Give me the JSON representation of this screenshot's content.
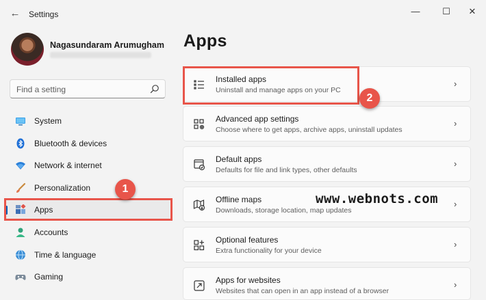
{
  "window": {
    "title": "Settings",
    "back_glyph": "←",
    "minimize_glyph": "—",
    "maximize_glyph": "☐",
    "close_glyph": "✕"
  },
  "profile": {
    "name": "Nagasundaram Arumugham"
  },
  "search": {
    "placeholder": "Find a setting",
    "icon": "search-icon"
  },
  "sidebar": {
    "items": [
      {
        "label": "System",
        "icon": "system-icon"
      },
      {
        "label": "Bluetooth & devices",
        "icon": "bluetooth-icon"
      },
      {
        "label": "Network & internet",
        "icon": "wifi-icon"
      },
      {
        "label": "Personalization",
        "icon": "brush-icon"
      },
      {
        "label": "Apps",
        "icon": "apps-icon",
        "active": true
      },
      {
        "label": "Accounts",
        "icon": "person-icon"
      },
      {
        "label": "Time & language",
        "icon": "globe-icon"
      },
      {
        "label": "Gaming",
        "icon": "gamepad-icon"
      }
    ]
  },
  "main": {
    "title": "Apps",
    "cards": [
      {
        "title": "Installed apps",
        "subtitle": "Uninstall and manage apps on your PC",
        "icon": "list-icon"
      },
      {
        "title": "Advanced app settings",
        "subtitle": "Choose where to get apps, archive apps, uninstall updates",
        "icon": "app-settings-icon"
      },
      {
        "title": "Default apps",
        "subtitle": "Defaults for file and link types, other defaults",
        "icon": "default-apps-icon"
      },
      {
        "title": "Offline maps",
        "subtitle": "Downloads, storage location, map updates",
        "icon": "map-icon"
      },
      {
        "title": "Optional features",
        "subtitle": "Extra functionality for your device",
        "icon": "optional-features-icon"
      },
      {
        "title": "Apps for websites",
        "subtitle": "Websites that can open in an app instead of a browser",
        "icon": "open-external-icon"
      }
    ],
    "chevron": "›"
  },
  "annotations": {
    "badge_1": "1",
    "badge_2": "2",
    "watermark": "www.webnots.com",
    "highlight_color": "#e8554a"
  },
  "colors": {
    "accent": "#005fb8",
    "background": "#f3f3f3",
    "card": "#fbfbfb"
  }
}
